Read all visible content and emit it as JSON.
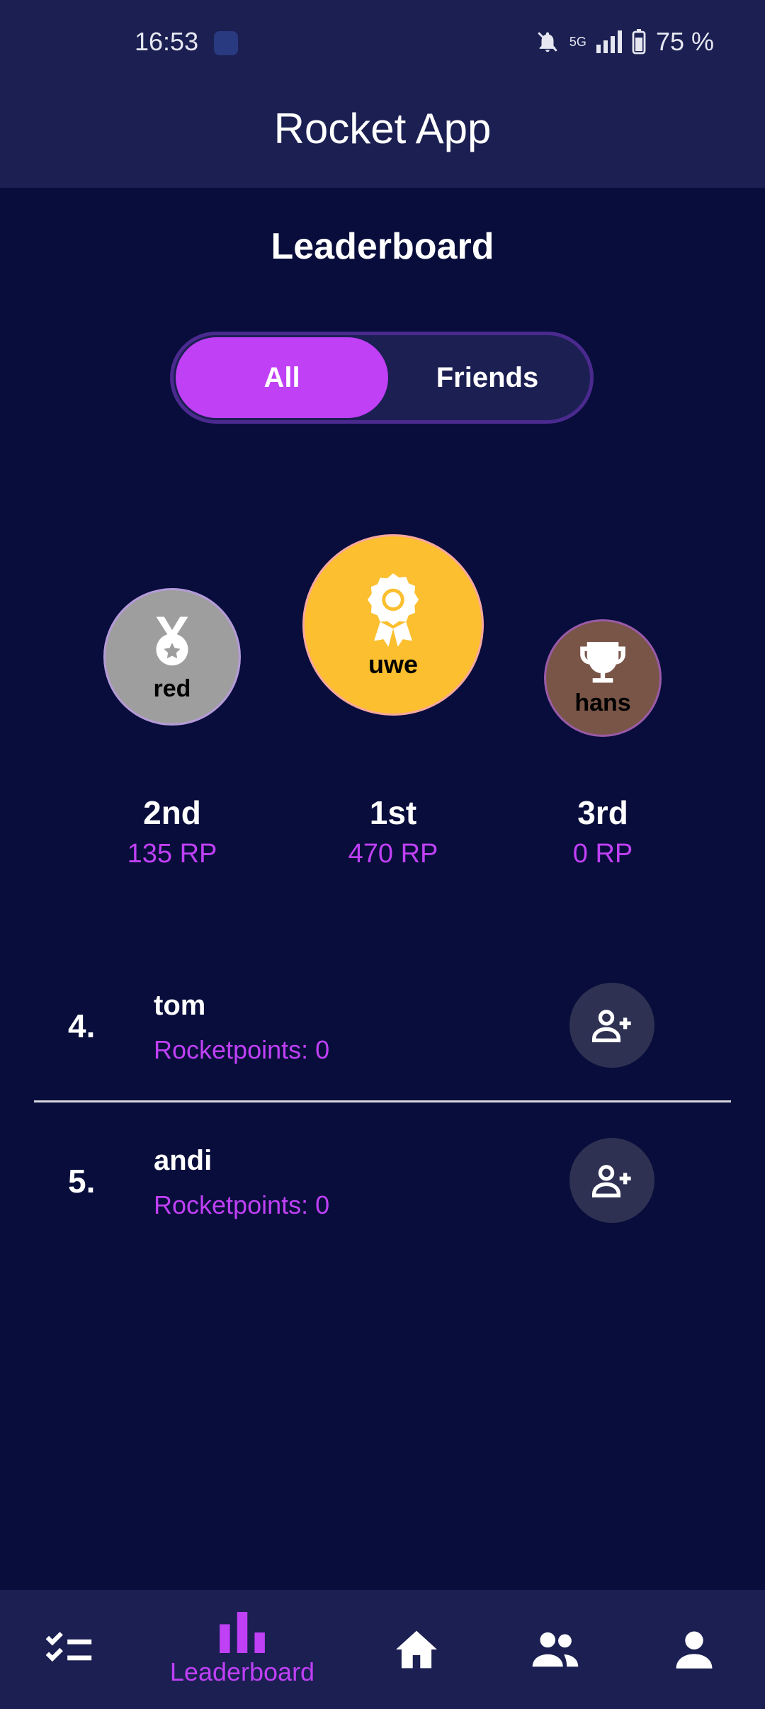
{
  "status": {
    "time": "16:53",
    "signal": "5G",
    "battery": "75 %"
  },
  "app": {
    "title": "Rocket App"
  },
  "page": {
    "title": "Leaderboard"
  },
  "toggle": {
    "all": "All",
    "friends": "Friends"
  },
  "podium": [
    {
      "name": "red",
      "place": "2nd",
      "points": "135 RP",
      "icon": "medal-icon",
      "color": "#9e9e9e"
    },
    {
      "name": "uwe",
      "place": "1st",
      "points": "470 RP",
      "icon": "award-ribbon-icon",
      "color": "#fbbf2f"
    },
    {
      "name": "hans",
      "place": "3rd",
      "points": "0 RP",
      "icon": "trophy-icon",
      "color": "#795548"
    }
  ],
  "list": [
    {
      "rank": "4.",
      "name": "tom",
      "points": "Rocketpoints: 0"
    },
    {
      "rank": "5.",
      "name": "andi",
      "points": "Rocketpoints: 0"
    }
  ],
  "nav": {
    "active_label": "Leaderboard"
  },
  "colors": {
    "accent": "#bf40f5",
    "background": "#080d3b",
    "bar": "#1b1f52"
  }
}
